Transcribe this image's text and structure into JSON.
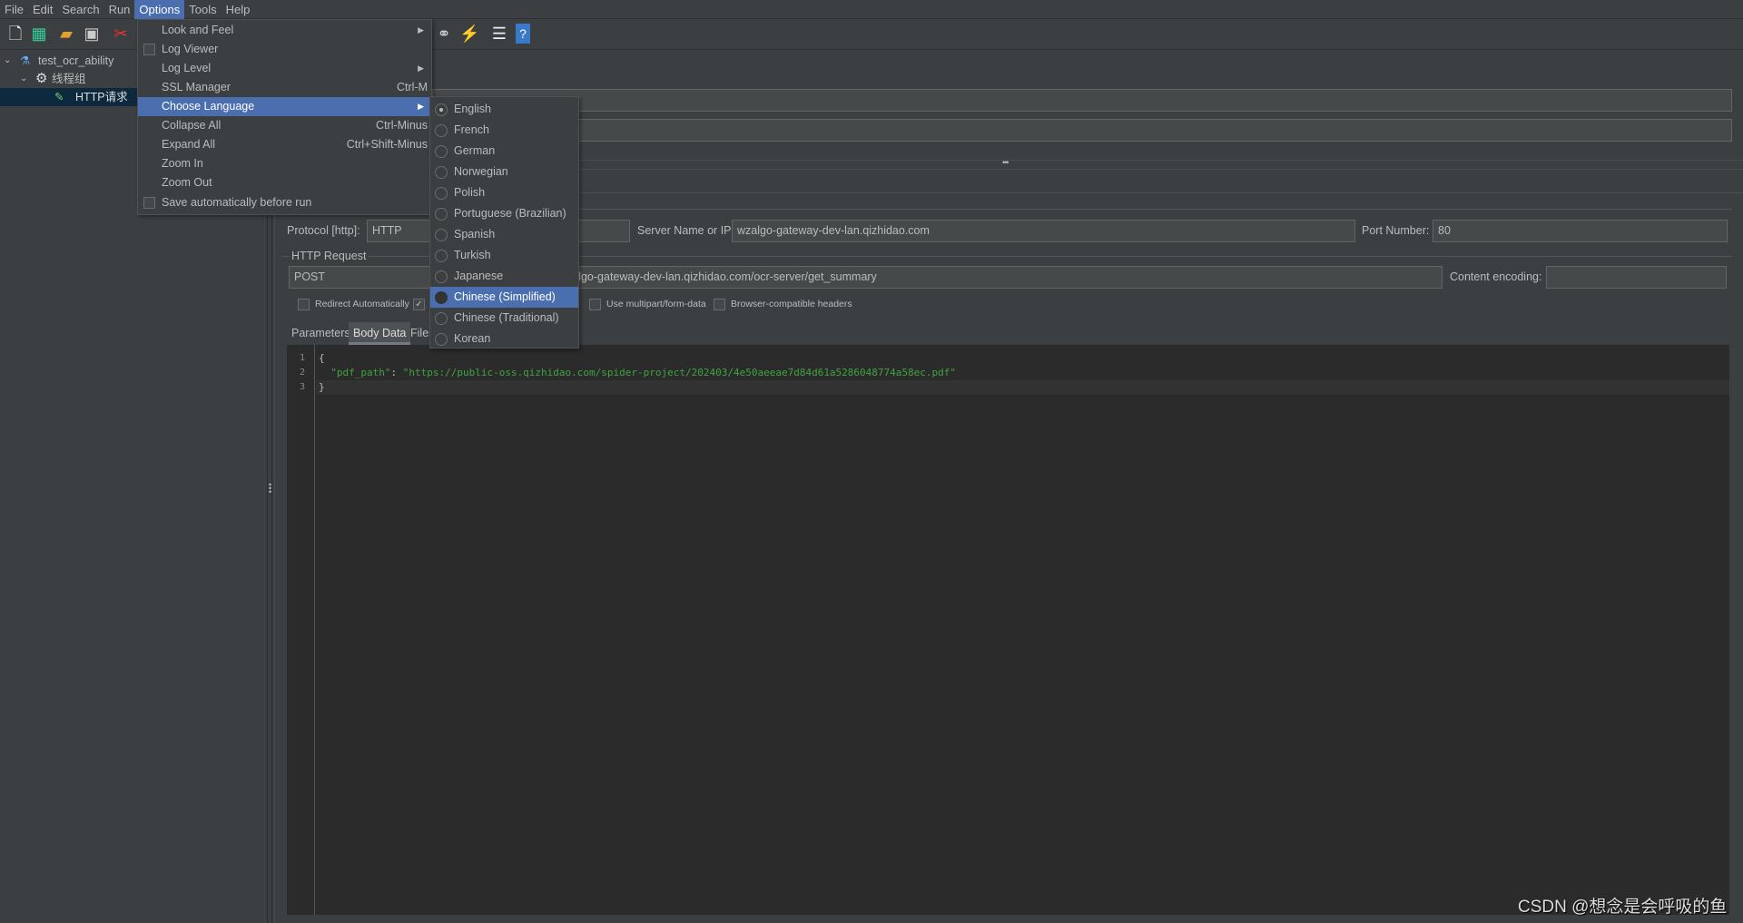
{
  "menubar": [
    "File",
    "Edit",
    "Search",
    "Run",
    "Options",
    "Tools",
    "Help"
  ],
  "toolbar": {
    "icons": [
      "new-file-icon",
      "templates-icon",
      "open-icon",
      "save-icon",
      "cut-icon",
      "search-binoculars-icon",
      "clear-broom-icon",
      "function-helper-icon",
      "help-icon"
    ]
  },
  "tree": {
    "items": [
      {
        "label": "test_ocr_ability",
        "icon": "test-plan-flask-icon"
      },
      {
        "label": "线程组",
        "icon": "thread-group-gear-icon"
      },
      {
        "label": "HTTP请求",
        "icon": "sampler-pipette-icon",
        "selected": true
      }
    ]
  },
  "options_menu": {
    "items": [
      {
        "label": "Look and Feel",
        "submenu": true
      },
      {
        "label": "Log Viewer",
        "checkbox": true
      },
      {
        "label": "Log Level",
        "submenu": true
      },
      {
        "label": "SSL Manager",
        "shortcut": "Ctrl-M"
      },
      {
        "label": "Choose Language",
        "submenu": true,
        "highlighted": true
      },
      {
        "label": "Collapse All",
        "shortcut": "Ctrl-Minus"
      },
      {
        "label": "Expand All",
        "shortcut": "Ctrl+Shift-Minus"
      },
      {
        "label": "Zoom In"
      },
      {
        "label": "Zoom Out"
      },
      {
        "label": "Save automatically before run",
        "checkbox": true
      }
    ]
  },
  "language_menu": {
    "selected": "English",
    "hovered": "Chinese (Simplified)",
    "items": [
      "English",
      "French",
      "German",
      "Norwegian",
      "Polish",
      "Portuguese (Brazilian)",
      "Spanish",
      "Turkish",
      "Japanese",
      "Chinese (Simplified)",
      "Chinese (Traditional)",
      "Korean"
    ]
  },
  "form": {
    "protocol_label": "Protocol [http]:",
    "protocol_value": "HTTP",
    "server_label": "Server Name or IP:",
    "server_value": "wzalgo-gateway-dev-lan.qizhidao.com",
    "port_label": "Port Number:",
    "port_value": "80",
    "http_request_label": "HTTP Request",
    "method_value": "POST",
    "path_value": "zalgo-gateway-dev-lan.qizhidao.com/ocr-server/get_summary",
    "encoding_label": "Content encoding:",
    "encoding_value": "",
    "checkboxes": [
      {
        "label": "Redirect Automatically",
        "checked": false
      },
      {
        "label": "",
        "checked": true
      },
      {
        "label": "Use multipart/form-data",
        "checked": false
      },
      {
        "label": "Browser-compatible headers",
        "checked": false
      }
    ]
  },
  "tabs": [
    "Parameters",
    "Body Data",
    "Files"
  ],
  "active_tab": "Body Data",
  "body": {
    "lines": [
      {
        "n": "1",
        "text": "{"
      },
      {
        "n": "2",
        "key": "\"pdf_path\"",
        "sep": ": ",
        "value": "\"https://public-oss.qizhidao.com/spider-project/202403/4e50aeeae7d84d61a5286048774a58ec.pdf\""
      },
      {
        "n": "3",
        "text": "}"
      }
    ]
  },
  "watermark": "CSDN @想念是会呼吸的鱼",
  "colors": {
    "accent": "#4b6eaf",
    "background": "#3c3f41",
    "editor": "#2b2b2b",
    "string": "#3fa33f"
  }
}
